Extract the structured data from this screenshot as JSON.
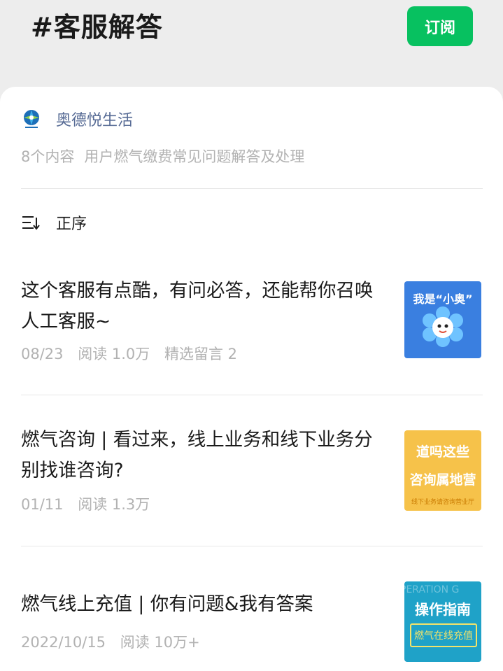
{
  "header": {
    "tag_title": "#客服解答",
    "subscribe_label": "订阅"
  },
  "collection": {
    "account_name": "奥德悦生活",
    "count_text": "8个内容",
    "description": "用户燃气缴费常见问题解答及处理",
    "sort_label": "正序"
  },
  "articles": [
    {
      "title": "这个客服有点酷，有问必答，还能帮你召唤人工客服~",
      "date": "08/23",
      "reads": "阅读 1.0万",
      "comments": "精选留言 2",
      "thumb_text": "我是“小奥”"
    },
    {
      "title": "燃气咨询 | 看过来，线上业务和线下业务分别找谁咨询?",
      "date": "01/11",
      "reads": "阅读 1.3万",
      "thumb_line1": "道吗这些",
      "thumb_line2": "咨询属地营",
      "thumb_small": "线下业务请咨询营业厅"
    },
    {
      "title": "燃气线上充值 | 你有问题&我有答案",
      "date": "2022/10/15",
      "reads": "阅读 10万+",
      "thumb_bg": "PERATION G",
      "thumb_title": "操作指南",
      "thumb_sub": "燃气在线充值"
    }
  ],
  "colors": {
    "accent_green": "#07c160",
    "link_blue": "#576b95",
    "meta_gray": "#b2b2b2"
  }
}
